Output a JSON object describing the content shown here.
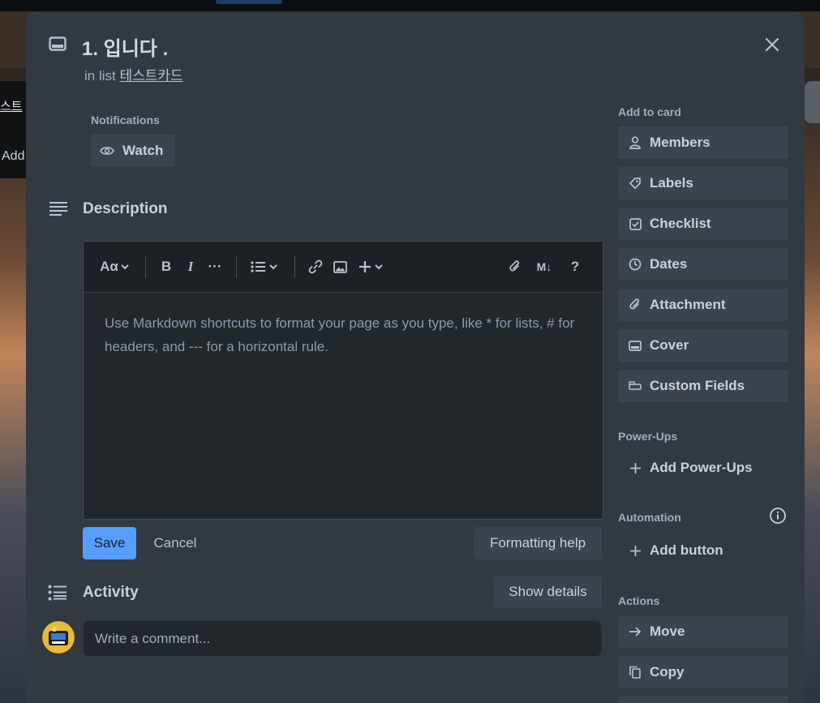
{
  "background": {
    "left_list_title": "스트",
    "left_list_add": "Add"
  },
  "card": {
    "title": "1. 입니다 .",
    "in_list_prefix": "in list",
    "list_name": "테스트카드"
  },
  "notifications": {
    "label": "Notifications",
    "watch_label": "Watch"
  },
  "description": {
    "title": "Description",
    "toolbar": {
      "text_style": "Aα",
      "bold": "B",
      "italic": "I",
      "more": "···",
      "markdown": "M↓",
      "help": "?"
    },
    "placeholder": "Use Markdown shortcuts to format your page as you type, like * for lists, # for headers, and --- for a horizontal rule.",
    "save_label": "Save",
    "cancel_label": "Cancel",
    "formatting_help_label": "Formatting help"
  },
  "activity": {
    "title": "Activity",
    "show_details_label": "Show details",
    "comment_placeholder": "Write a comment..."
  },
  "sidebar": {
    "add_to_card_label": "Add to card",
    "add_to_card": [
      {
        "label": "Members",
        "icon": "person-icon"
      },
      {
        "label": "Labels",
        "icon": "tag-icon"
      },
      {
        "label": "Checklist",
        "icon": "checkbox-icon"
      },
      {
        "label": "Dates",
        "icon": "clock-icon"
      },
      {
        "label": "Attachment",
        "icon": "paperclip-icon"
      },
      {
        "label": "Cover",
        "icon": "card-cover-icon"
      },
      {
        "label": "Custom Fields",
        "icon": "custom-field-icon"
      }
    ],
    "power_ups_label": "Power-Ups",
    "add_power_ups_label": "Add Power-Ups",
    "automation_label": "Automation",
    "add_button_label": "Add button",
    "actions_label": "Actions",
    "actions": [
      {
        "label": "Move",
        "icon": "arrow-right-icon"
      },
      {
        "label": "Copy",
        "icon": "copy-icon"
      }
    ]
  },
  "colors": {
    "modal_bg": "#323940",
    "button_bg": "#3b434c",
    "primary": "#579dff",
    "text": "#c7d1db",
    "muted": "#9fadbc"
  }
}
